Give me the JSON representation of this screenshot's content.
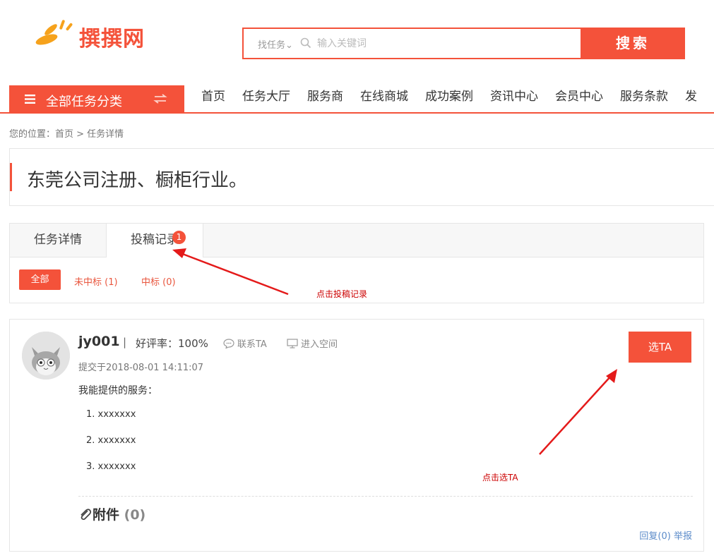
{
  "header": {
    "logo_text": "撰撰网",
    "search": {
      "type_label": "找任务",
      "placeholder": "输入关键词",
      "button_label": "搜索"
    }
  },
  "nav": {
    "all_categories": "全部任务分类",
    "items": [
      "首页",
      "任务大厅",
      "服务商",
      "在线商城",
      "成功案例",
      "资讯中心",
      "会员中心",
      "服务条款",
      "发"
    ]
  },
  "breadcrumb": "您的位置：首页 > 任务详情",
  "task": {
    "title": "东莞公司注册、橱柜行业。"
  },
  "tabs": {
    "items": [
      "任务详情",
      "投稿记录"
    ],
    "badge": "1",
    "filters": {
      "all": "全部",
      "unselected": "未中标 (1)",
      "selected": "中标 (0)"
    }
  },
  "annotations": {
    "click_records": "点击投稿记录",
    "click_choose": "点击选TA"
  },
  "bid": {
    "username": "jy001",
    "separator": "|",
    "rating": "好评率：100%",
    "contact": "联系TA",
    "space": "进入空间",
    "submitted": "提交于2018-08-01 14:11:07",
    "services_label": "我能提供的服务：",
    "services": [
      "1. xxxxxxx",
      "2. xxxxxxx",
      "3. xxxxxxx"
    ],
    "attachments_label": "附件",
    "attachments_count": "(0)",
    "reply": "回复(0)",
    "report": "举报",
    "choose_button": "选TA"
  },
  "colors": {
    "accent": "#f4523a",
    "annotation": "#cc0000",
    "link": "#5b8bc9"
  }
}
